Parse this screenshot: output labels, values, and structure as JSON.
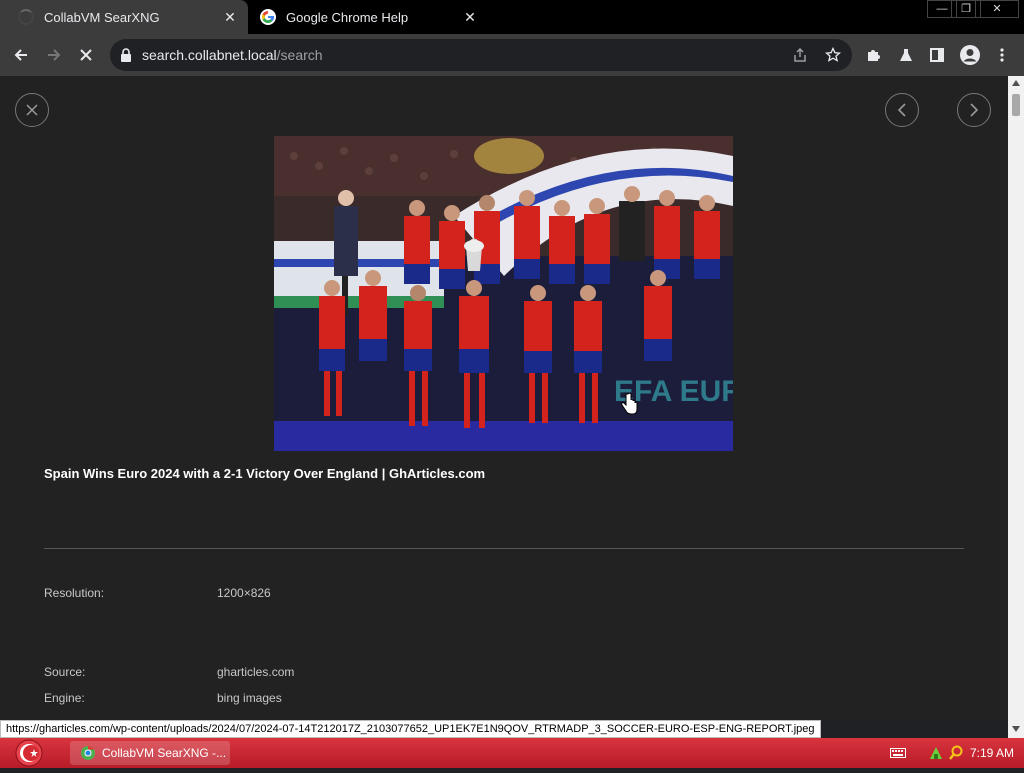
{
  "tabs": [
    {
      "title": "CollabVM SearXNG",
      "state": "loading"
    },
    {
      "title": "Google Chrome Help",
      "state": "loaded"
    }
  ],
  "window_controls": {
    "minimize": "—",
    "restore": "❐",
    "close": "✕"
  },
  "toolbar": {
    "url_host": "search.collabnet.local",
    "url_path": "/search",
    "icons": [
      "back-icon",
      "forward-icon",
      "stop-icon",
      "lock-icon",
      "share-icon",
      "star-icon",
      "extensions-icon",
      "labs-icon",
      "side-panel-icon",
      "profile-icon",
      "menu-icon"
    ]
  },
  "viewer": {
    "close_label": "✕",
    "prev_label": "‹",
    "next_label": "›",
    "image_alt": "Spain national team celebrating with Euro 2024 trophy",
    "image_banner_text": "EFA EUR",
    "title": "Spain Wins Euro 2024 with a 2-1 Victory Over England | GhArticles.com",
    "meta": [
      {
        "label": "Resolution:",
        "value": "1200×826"
      },
      {
        "label": "Source:",
        "value": "gharticles.com"
      },
      {
        "label": "Engine:",
        "value": "bing images"
      }
    ]
  },
  "status_url": "https://gharticles.com/wp-content/uploads/2024/07/2024-07-14T212017Z_2103077652_UP1EK7E1N9QOV_RTRMADP_3_SOCCER-EURO-ESP-ENG-REPORT.jpeg",
  "taskbar": {
    "task_label": "CollabVM SearXNG -...",
    "clock": "7:19 AM"
  },
  "colors": {
    "content_bg": "#222222",
    "taskbar_red": "#c62832",
    "spain_red": "#d4231d",
    "spain_blue": "#1a2a8a"
  }
}
